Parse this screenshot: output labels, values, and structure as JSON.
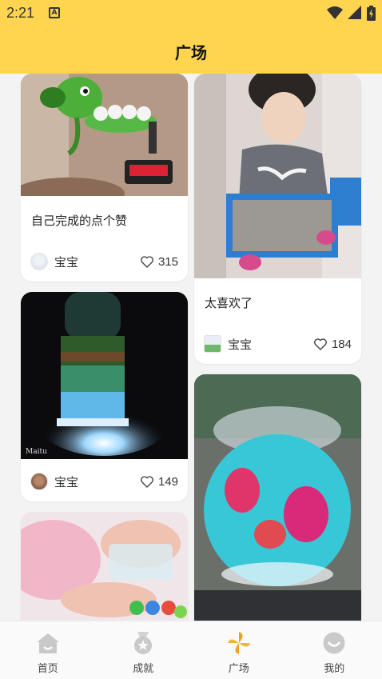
{
  "status": {
    "time": "2:21",
    "sim_label": "A"
  },
  "header": {
    "title": "广场"
  },
  "posts": [
    {
      "caption": "自己完成的点个赞",
      "user": "宝宝",
      "likes": "315",
      "icon": "heart-outline"
    },
    {
      "caption": "太喜欢了",
      "user": "宝宝",
      "likes": "184",
      "icon": "heart-outline"
    },
    {
      "caption": "",
      "user": "宝宝",
      "likes": "149",
      "icon": "heart-outline"
    },
    {
      "caption": "",
      "user": "",
      "likes": ""
    },
    {
      "caption": "",
      "user": "",
      "likes": ""
    }
  ],
  "nav": [
    {
      "label": "首页",
      "icon": "home-icon",
      "active": false
    },
    {
      "label": "成就",
      "icon": "medal-icon",
      "active": false
    },
    {
      "label": "广场",
      "icon": "pinwheel-icon",
      "active": true
    },
    {
      "label": "我的",
      "icon": "smile-face-icon",
      "active": false
    }
  ],
  "colors": {
    "accent": "#ffd54f",
    "active": "#f0a020",
    "inactive": "#c7c7c7"
  }
}
